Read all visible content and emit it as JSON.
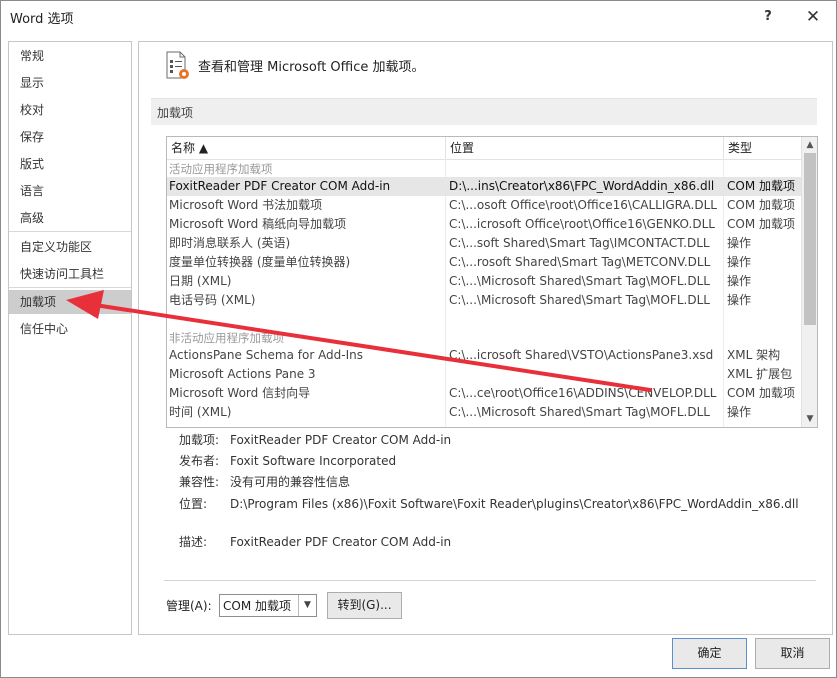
{
  "window": {
    "title": "Word 选项",
    "help_glyph": "?",
    "close_glyph": "✕"
  },
  "nav": {
    "items": [
      {
        "label": "常规"
      },
      {
        "label": "显示"
      },
      {
        "label": "校对"
      },
      {
        "label": "保存"
      },
      {
        "label": "版式"
      },
      {
        "label": "语言"
      },
      {
        "label": "高级"
      },
      {
        "label": "自定义功能区"
      },
      {
        "label": "快速访问工具栏"
      },
      {
        "label": "加载项",
        "selected": true
      },
      {
        "label": "信任中心"
      }
    ]
  },
  "header": {
    "text": "查看和管理 Microsoft Office 加载项。"
  },
  "section": {
    "title": "加载项"
  },
  "table": {
    "columns": {
      "name": "名称 ▲",
      "location": "位置",
      "type": "类型"
    },
    "groups": [
      {
        "label": "活动应用程序加载项",
        "rows": [
          {
            "name": "FoxitReader PDF Creator COM Add-in",
            "location": "D:\\...ins\\Creator\\x86\\FPC_WordAddin_x86.dll",
            "type": "COM 加载项",
            "selected": true
          },
          {
            "name": "Microsoft Word 书法加载项",
            "location": "C:\\...osoft Office\\root\\Office16\\CALLIGRA.DLL",
            "type": "COM 加载项"
          },
          {
            "name": "Microsoft Word 稿纸向导加载项",
            "location": "C:\\...icrosoft Office\\root\\Office16\\GENKO.DLL",
            "type": "COM 加载项"
          },
          {
            "name": "即时消息联系人 (英语)",
            "location": "C:\\...soft Shared\\Smart Tag\\IMCONTACT.DLL",
            "type": "操作"
          },
          {
            "name": "度量单位转换器 (度量单位转换器)",
            "location": "C:\\...rosoft Shared\\Smart Tag\\METCONV.DLL",
            "type": "操作"
          },
          {
            "name": "日期 (XML)",
            "location": "C:\\...\\Microsoft Shared\\Smart Tag\\MOFL.DLL",
            "type": "操作"
          },
          {
            "name": "电话号码 (XML)",
            "location": "C:\\...\\Microsoft Shared\\Smart Tag\\MOFL.DLL",
            "type": "操作"
          }
        ]
      },
      {
        "label": "非活动应用程序加载项",
        "rows": [
          {
            "name": "ActionsPane Schema for Add-Ins",
            "location": "C:\\...icrosoft Shared\\VSTO\\ActionsPane3.xsd",
            "type": "XML 架构"
          },
          {
            "name": "Microsoft Actions Pane 3",
            "location": "",
            "type": "XML 扩展包"
          },
          {
            "name": "Microsoft Word 信封向导",
            "location": "C:\\...ce\\root\\Office16\\ADDINS\\CENVELOP.DLL",
            "type": "COM 加载项"
          },
          {
            "name": "时间 (XML)",
            "location": "C:\\...\\Microsoft Shared\\Smart Tag\\MOFL.DLL",
            "type": "操作"
          }
        ]
      }
    ]
  },
  "details": {
    "addin_label": "加载项:",
    "addin_value": "FoxitReader PDF Creator COM Add-in",
    "publisher_label": "发布者:",
    "publisher_value": "Foxit Software Incorporated",
    "compat_label": "兼容性:",
    "compat_value": "没有可用的兼容性信息",
    "location_label": "位置:",
    "location_value": "D:\\Program Files (x86)\\Foxit Software\\Foxit Reader\\plugins\\Creator\\x86\\FPC_WordAddin_x86.dll",
    "desc_label": "描述:",
    "desc_value": "FoxitReader PDF Creator COM Add-in"
  },
  "manage": {
    "label": "管理(A):",
    "selected": "COM 加载项",
    "goto_label": "转到(G)..."
  },
  "buttons": {
    "ok": "确定",
    "cancel": "取消"
  },
  "colors": {
    "annotation_arrow": "#e8303a",
    "selection": "#cdcdcd",
    "addin_icon_accent": "#e8742a"
  },
  "icons": {
    "header": "addin-gear-icon",
    "sort": "sort-ascending-icon",
    "scroll_up": "scroll-up-icon",
    "scroll_down": "scroll-down-icon",
    "combo": "chevron-down-icon"
  }
}
